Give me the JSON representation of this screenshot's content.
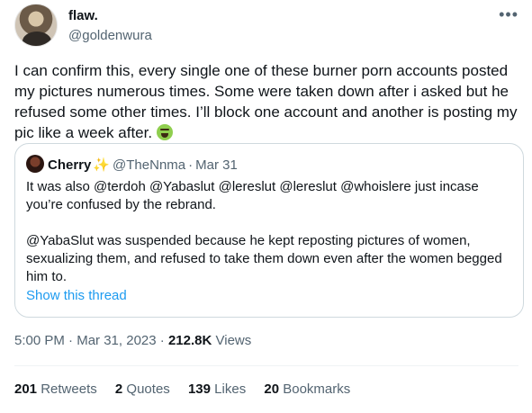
{
  "author": {
    "display_name": "flaw.",
    "handle": "@goldenwura"
  },
  "more_icon": "more-horizontal-icon",
  "tweet_text": "I can confirm this, every single one of these burner porn accounts posted my pictures numerous times. Some were taken down after i asked but he refused some other times. I’ll block one account and another is posting my pic like a week after.",
  "tweet_emoji": "face-vomiting-emoji",
  "quote": {
    "display_name": "Cherry",
    "sparkle": "✨",
    "handle": "@TheNnma",
    "separator": "·",
    "date": "Mar 31",
    "paragraph_1": "It was also @terdoh @Yabaslut @lereslut @lereslut @whoislere just incase you’re confused by the rebrand.",
    "paragraph_2": "@YabaSlut was suspended because he kept reposting pictures of women, sexualizing them, and refused to take them down even after the women begged him to.",
    "show_thread": "Show this thread"
  },
  "meta": {
    "time": "5:00 PM",
    "separator": "·",
    "date": "Mar 31, 2023",
    "views_count": "212.8K",
    "views_label": "Views"
  },
  "stats": [
    {
      "count": "201",
      "label": "Retweets"
    },
    {
      "count": "2",
      "label": "Quotes"
    },
    {
      "count": "139",
      "label": "Likes"
    },
    {
      "count": "20",
      "label": "Bookmarks"
    }
  ],
  "colors": {
    "text": "#0f1419",
    "secondary": "#536471",
    "link": "#1d9bf0",
    "border": "#cfd9de"
  }
}
